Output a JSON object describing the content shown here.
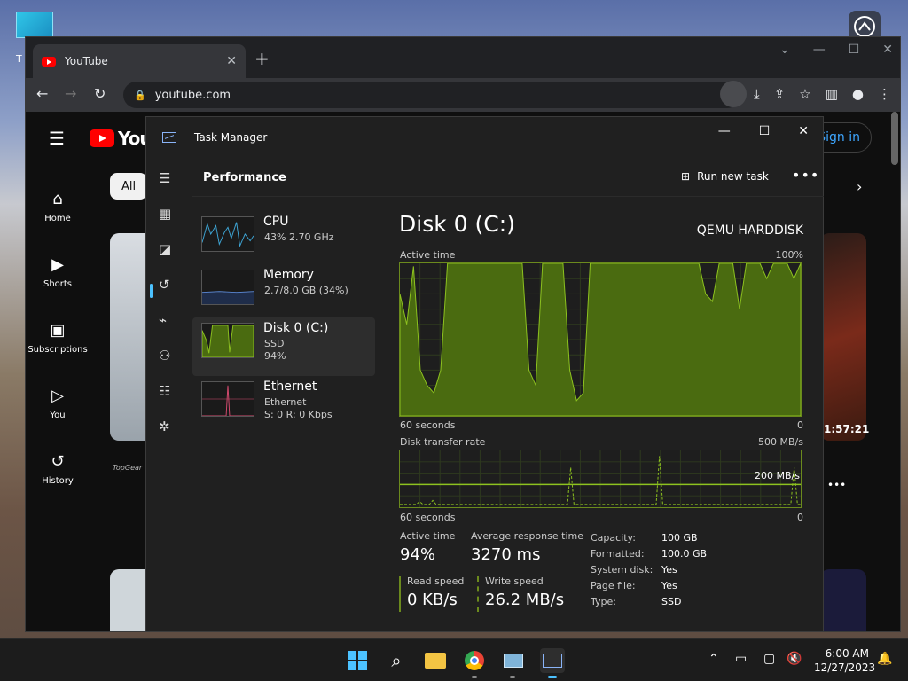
{
  "desktop": {
    "icon_label": "T"
  },
  "browser": {
    "tab_title": "YouTube",
    "tab_close": "✕",
    "new_tab": "+",
    "url": "youtube.com"
  },
  "youtube": {
    "logo_text": "YouT",
    "chip_all": "All",
    "signin": "Sign in",
    "sidebar": [
      {
        "label": "Home",
        "icon": "home-icon"
      },
      {
        "label": "Shorts",
        "icon": "shorts-icon"
      },
      {
        "label": "Subscriptions",
        "icon": "subscriptions-icon"
      },
      {
        "label": "You",
        "icon": "you-icon"
      },
      {
        "label": "History",
        "icon": "history-icon"
      }
    ],
    "duration": "1:57:21",
    "channel_logo": "TopGear"
  },
  "taskmanager": {
    "title": "Task Manager",
    "page_title": "Performance",
    "run_new_task": "Run new task",
    "more": "•••",
    "perf_items": [
      {
        "name": "CPU",
        "sub1": "43%  2.70 GHz",
        "sub2": "",
        "color": "#3ea6d6"
      },
      {
        "name": "Memory",
        "sub1": "2.7/8.0 GB (34%)",
        "sub2": "",
        "color": "#5a88d6"
      },
      {
        "name": "Disk 0 (C:)",
        "sub1": "SSD",
        "sub2": "94%",
        "color": "#8dc21f"
      },
      {
        "name": "Ethernet",
        "sub1": "Ethernet",
        "sub2": "S: 0  R: 0 Kbps",
        "color": "#d34a6e"
      }
    ],
    "detail": {
      "title": "Disk 0 (C:)",
      "model": "QEMU HARDDISK",
      "active_time_label": "Active time",
      "active_time_max": "100%",
      "seconds_label": "60 seconds",
      "zero": "0",
      "transfer_label": "Disk transfer rate",
      "transfer_max": "500 MB/s",
      "transfer_mark": "200 MB/s",
      "active_time_value_label": "Active time",
      "active_time_value": "94%",
      "avg_resp_label": "Average response time",
      "avg_resp_value": "3270 ms",
      "read_label": "Read speed",
      "read_value": "0 KB/s",
      "write_label": "Write speed",
      "write_value": "26.2 MB/s",
      "props": [
        {
          "k": "Capacity:",
          "v": "100 GB"
        },
        {
          "k": "Formatted:",
          "v": "100.0 GB"
        },
        {
          "k": "System disk:",
          "v": "Yes"
        },
        {
          "k": "Page file:",
          "v": "Yes"
        },
        {
          "k": "Type:",
          "v": "SSD"
        }
      ],
      "active_series": [
        80,
        60,
        98,
        30,
        20,
        15,
        30,
        100,
        100,
        100,
        100,
        100,
        100,
        100,
        100,
        100,
        100,
        100,
        100,
        30,
        20,
        100,
        100,
        100,
        100,
        30,
        10,
        15,
        100,
        100,
        100,
        100,
        100,
        100,
        100,
        100,
        100,
        100,
        100,
        100,
        100,
        100,
        100,
        100,
        100,
        80,
        75,
        100,
        100,
        100,
        70,
        100,
        100,
        100,
        90,
        100,
        100,
        100,
        90,
        100
      ],
      "transfer_series": [
        5,
        5,
        5,
        5,
        5,
        5,
        10,
        5,
        5,
        5,
        12,
        5,
        5,
        5,
        5,
        5,
        5,
        5,
        5,
        5,
        5,
        5,
        5,
        5,
        5,
        5,
        5,
        5,
        5,
        5,
        5,
        5,
        5,
        5,
        5,
        5,
        5,
        5,
        5,
        5,
        5,
        5,
        5,
        5,
        5,
        5,
        5,
        5,
        5,
        5,
        5,
        5,
        70,
        5,
        5,
        5,
        5,
        5,
        5,
        5,
        5,
        5,
        5,
        5,
        5,
        5,
        5,
        5,
        5,
        5,
        5,
        5,
        5,
        5,
        5,
        5,
        5,
        5,
        5,
        90,
        5,
        5,
        5,
        5,
        5,
        5,
        5,
        5,
        5,
        5,
        5,
        5,
        5,
        5,
        5,
        5,
        5,
        5,
        5,
        5,
        5,
        5,
        5,
        5,
        5,
        5,
        5,
        5,
        5,
        5,
        5,
        5,
        5,
        5,
        5,
        5,
        5,
        5,
        5,
        5,
        70,
        5,
        5
      ]
    }
  },
  "taskbar": {
    "time": "6:00 AM",
    "date": "12/27/2023"
  },
  "colors": {
    "accent": "#4cc2ff",
    "disk_green": "#8dc21f",
    "yt_red": "#ff0000",
    "link_blue": "#3ea6ff"
  }
}
